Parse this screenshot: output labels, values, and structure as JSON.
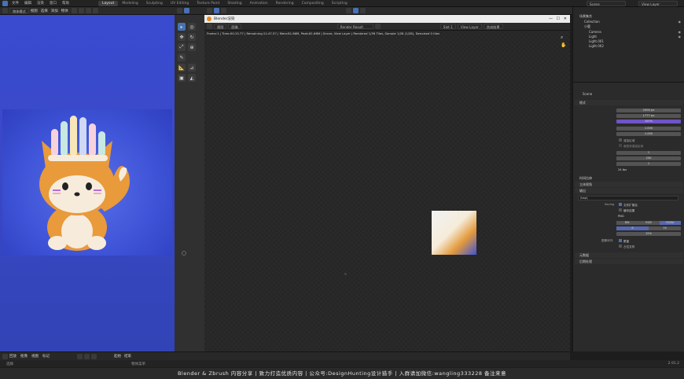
{
  "topbar": {
    "menus": [
      "文件",
      "编辑",
      "渲染",
      "窗口",
      "帮助"
    ],
    "workspaces": [
      "Layout",
      "Modeling",
      "Sculpting",
      "UV Editing",
      "Texture Paint",
      "Shading",
      "Animation",
      "Rendering",
      "Compositing",
      "Scripting"
    ],
    "active_workspace": "Layout",
    "scene": "Scene",
    "view_layer": "View Layer"
  },
  "left_editor": {
    "mode": "物体模式",
    "menus": [
      "视图",
      "选择",
      "添加",
      "物体"
    ],
    "shading": "Material Preview"
  },
  "render_window": {
    "title": "Blender渲染",
    "menus": [
      "视图",
      "图像"
    ],
    "image_name": "Render Result",
    "slot": "Slot 1",
    "layer": "View Layer",
    "pass": "合成结果",
    "info": "Frame:1 | Time:00:15.77 | Remaining:11:47.57 | Mem:81.66M, Peak:81.66M | Scene, View Layer | Rendered 1/36 Tiles, Sample 1/28 (1/28), Denoised 0 tiles"
  },
  "outliner": {
    "title": "场景集合",
    "items": [
      "Collection",
      "小鹿",
      "Camera",
      "Light",
      "Light.001",
      "Light.002"
    ]
  },
  "properties": {
    "scene_name": "Scene",
    "section_dimensions": "格式",
    "rows": [
      {
        "label": "分辨率 X",
        "value": "2000 px"
      },
      {
        "label": "Y",
        "value": "1777 px"
      },
      {
        "label": "%",
        "value": "100%"
      },
      {
        "label": "纵横比 X",
        "value": "1.000"
      },
      {
        "label": "Y",
        "value": "1.000"
      },
      {
        "label": "起始帧",
        "value": "1"
      },
      {
        "label": "结束帧",
        "value": "250"
      },
      {
        "label": "步长",
        "value": "1"
      },
      {
        "label": "帧率",
        "value": "24 fps"
      }
    ],
    "checkbox_border": "渲染区域",
    "checkbox_crop": "裁剪到渲染区域",
    "section_time": "时间拉伸",
    "section_stereo": "立体视角",
    "section_output": "输出",
    "output_path": "/tmp\\",
    "saving": "Saving",
    "file_ext": "文件扩展名",
    "cache": "缓存结果",
    "format_label": "文件格式",
    "format_value": "PNG",
    "color_label": "颜色",
    "color_opts": [
      "BW",
      "RGB",
      "RGBA"
    ],
    "depth_label": "色深",
    "depth_opts": [
      "8",
      "16"
    ],
    "compression_label": "压缩",
    "compression_value": "15%",
    "image_seq": "图像序列",
    "overwrite": "覆盖",
    "placeholders": "占位文件",
    "section_meta": "元数据",
    "section_post": "后期处理"
  },
  "timeline": {
    "playback": "回放",
    "keying": "抠像",
    "view": "视图",
    "marker": "标记",
    "frame_start": "起始",
    "frame_end": "结束"
  },
  "status": {
    "left": "选择",
    "mid": "物体菜单",
    "version": "2.91.2"
  },
  "banner": "Blender & Zbrush 内容分享  |  致力打造优质内容  |  公众号:DesignHunting设计猎手  |  入群请加微信:wangling333228 备注来意"
}
